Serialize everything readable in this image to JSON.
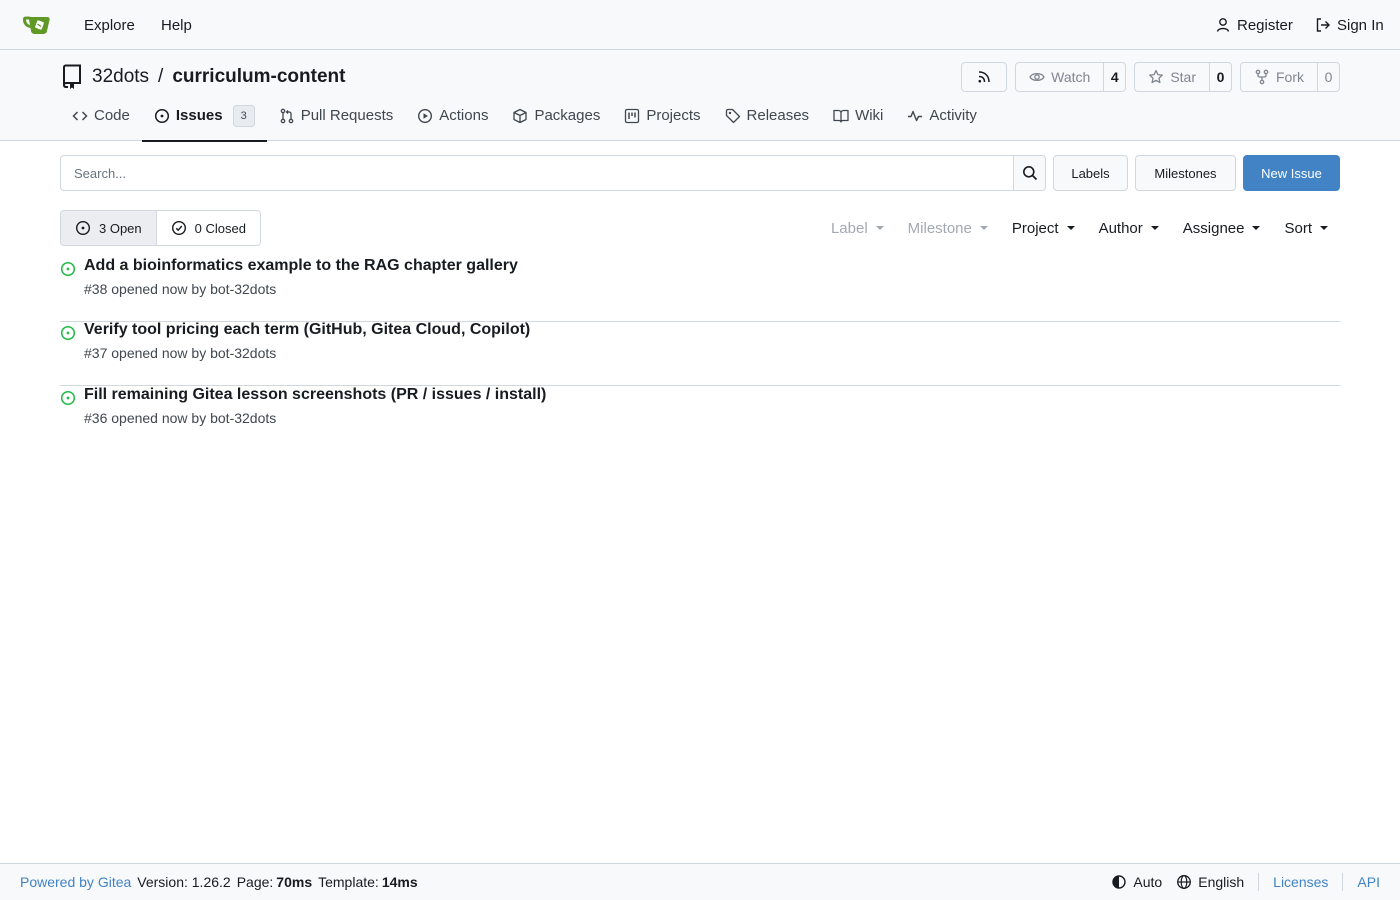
{
  "navbar": {
    "explore": "Explore",
    "help": "Help",
    "register": "Register",
    "sign_in": "Sign In"
  },
  "repo": {
    "owner": "32dots",
    "separator": "/",
    "name": "curriculum-content",
    "watch_label": "Watch",
    "watch_count": "4",
    "star_label": "Star",
    "star_count": "0",
    "fork_label": "Fork",
    "fork_count": "0"
  },
  "tabs": [
    {
      "label": "Code"
    },
    {
      "label": "Issues",
      "badge": "3"
    },
    {
      "label": "Pull Requests"
    },
    {
      "label": "Actions"
    },
    {
      "label": "Packages"
    },
    {
      "label": "Projects"
    },
    {
      "label": "Releases"
    },
    {
      "label": "Wiki"
    },
    {
      "label": "Activity"
    }
  ],
  "toolbar": {
    "search_placeholder": "Search...",
    "labels": "Labels",
    "milestones": "Milestones",
    "new_issue": "New Issue"
  },
  "states": {
    "open": "3 Open",
    "closed": "0 Closed"
  },
  "filters": {
    "label": "Label",
    "milestone": "Milestone",
    "project": "Project",
    "author": "Author",
    "assignee": "Assignee",
    "sort": "Sort"
  },
  "issues": [
    {
      "title": "Add a bioinformatics example to the RAG chapter gallery",
      "meta": "#38 opened now by bot-32dots"
    },
    {
      "title": "Verify tool pricing each term (GitHub, Gitea Cloud, Copilot)",
      "meta": "#37 opened now by bot-32dots"
    },
    {
      "title": "Fill remaining Gitea lesson screenshots (PR / issues / install)",
      "meta": "#36 opened now by bot-32dots"
    }
  ],
  "footer": {
    "powered_by": "Powered by Gitea",
    "version": "Version: 1.26.2",
    "page_label": "Page:",
    "page_time": "70ms",
    "template_label": "Template:",
    "template_time": "14ms",
    "theme": "Auto",
    "language": "English",
    "licenses": "Licenses",
    "api": "API"
  },
  "colors": {
    "accent": "#4183c4",
    "open_status": "#21ba45",
    "logo": "#609926"
  },
  "icons": [
    "gitea-logo",
    "person-icon",
    "sign-in-icon",
    "repo-icon",
    "rss-icon",
    "eye-icon",
    "star-icon",
    "fork-icon",
    "code-icon",
    "issue-opened-icon",
    "pull-request-icon",
    "play-icon",
    "package-icon",
    "project-icon",
    "tag-icon",
    "book-icon",
    "pulse-icon",
    "search-icon",
    "issue-closed-icon",
    "theme-icon",
    "globe-icon"
  ]
}
